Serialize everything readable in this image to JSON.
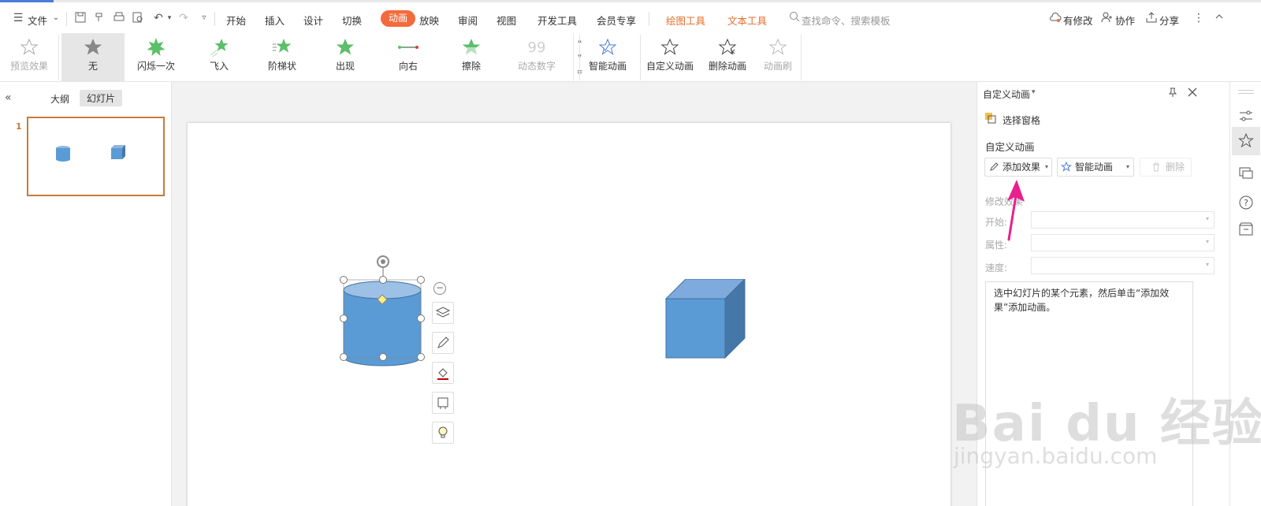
{
  "titlebar": {
    "file_label": "文件",
    "tabs": [
      "开始",
      "插入",
      "设计",
      "切换",
      "动画",
      "放映",
      "审阅",
      "视图",
      "开发工具",
      "会员专享"
    ],
    "context_tabs": [
      "绘图工具",
      "文本工具"
    ],
    "search_placeholder": "查找命令、搜索模板",
    "status": "有修改",
    "collab": "协作",
    "share": "分享"
  },
  "ribbon": {
    "preview": "预览效果",
    "effects": [
      "无",
      "闪烁一次",
      "飞入",
      "阶梯状",
      "出现",
      "向右",
      "擦除",
      "动态数字"
    ],
    "smart_animation": "智能动画",
    "custom_animation": "自定义动画",
    "delete_animation": "删除动画",
    "animation_brush": "动画刷"
  },
  "leftpane": {
    "tab_outline": "大纲",
    "tab_slides": "幻灯片",
    "slide_number": "1"
  },
  "rightpane": {
    "title": "自定义动画",
    "selection_pane": "选择窗格",
    "section_title": "自定义动画",
    "add_effect": "添加效果",
    "smart_animation": "智能动画",
    "delete": "删除",
    "modify_title": "修改效果",
    "start_label": "开始:",
    "property_label": "属性:",
    "speed_label": "速度:",
    "hint": "选中幻灯片的某个元素，然后单击“添加效果”添加动画。"
  },
  "watermark": {
    "brand": "Bai du 经验",
    "url": "jingyan.baidu.com"
  },
  "colors": {
    "accent": "#f36b3c",
    "shape_fill": "#5b9bd5",
    "arrow": "#e8208e",
    "thumb_border": "#c87a3b"
  }
}
